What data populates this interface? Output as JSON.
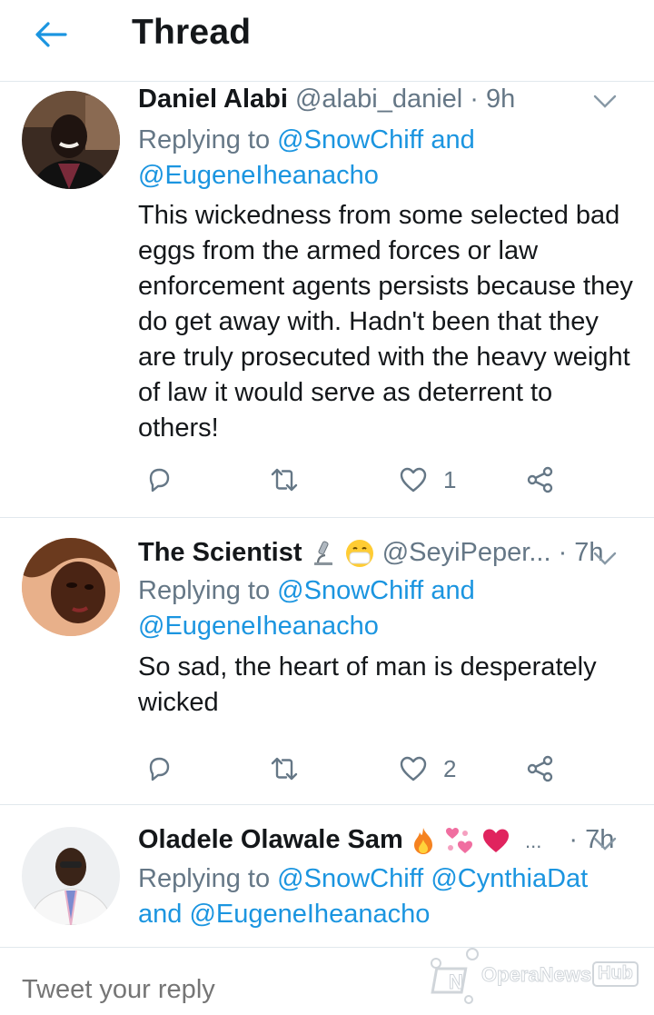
{
  "header": {
    "title": "Thread"
  },
  "tweets": [
    {
      "display_name": "Daniel Alabi",
      "handle": "@alabi_daniel",
      "dot": "·",
      "time": "9h",
      "reply_prefix": "Replying to",
      "mentions": [
        "@SnowChiff",
        "@EugeneIheanacho"
      ],
      "connector": "and",
      "text": "This wickedness from some selected bad eggs from the armed forces or law enforcement agents persists because they do get away with. Hadn't been that they are truly prosecuted with the heavy weight of law it would serve as deterrent to others!",
      "like_count": "1"
    },
    {
      "display_name": "The Scientist",
      "name_emojis": [
        "microscope",
        "face-with-medical-mask"
      ],
      "handle": "@SeyiPeper...",
      "dot": "·",
      "time": "7h",
      "reply_prefix": "Replying to",
      "mentions": [
        "@SnowChiff",
        "@EugeneIheanacho"
      ],
      "connector": "and",
      "text": "So sad, the heart of man is desperately wicked",
      "like_count": "2"
    },
    {
      "display_name": "Oladele Olawale Sam",
      "name_emojis": [
        "fire",
        "revolving-hearts",
        "red-heart"
      ],
      "ellipsis": "...",
      "dot": "·",
      "time": "7h",
      "reply_prefix": "Replying to",
      "mentions": [
        "@SnowChiff",
        "@CynthiaDat",
        "@EugeneIheanacho"
      ],
      "connector": "and"
    }
  ],
  "reply_bar": {
    "placeholder": "Tweet your reply"
  },
  "watermark": {
    "text": "OperaNews",
    "hub": "Hub"
  },
  "colors": {
    "accent": "#1b95e0",
    "secondary_text": "#657786",
    "divider": "#e1e8ed",
    "like_red": "#e0245e"
  }
}
